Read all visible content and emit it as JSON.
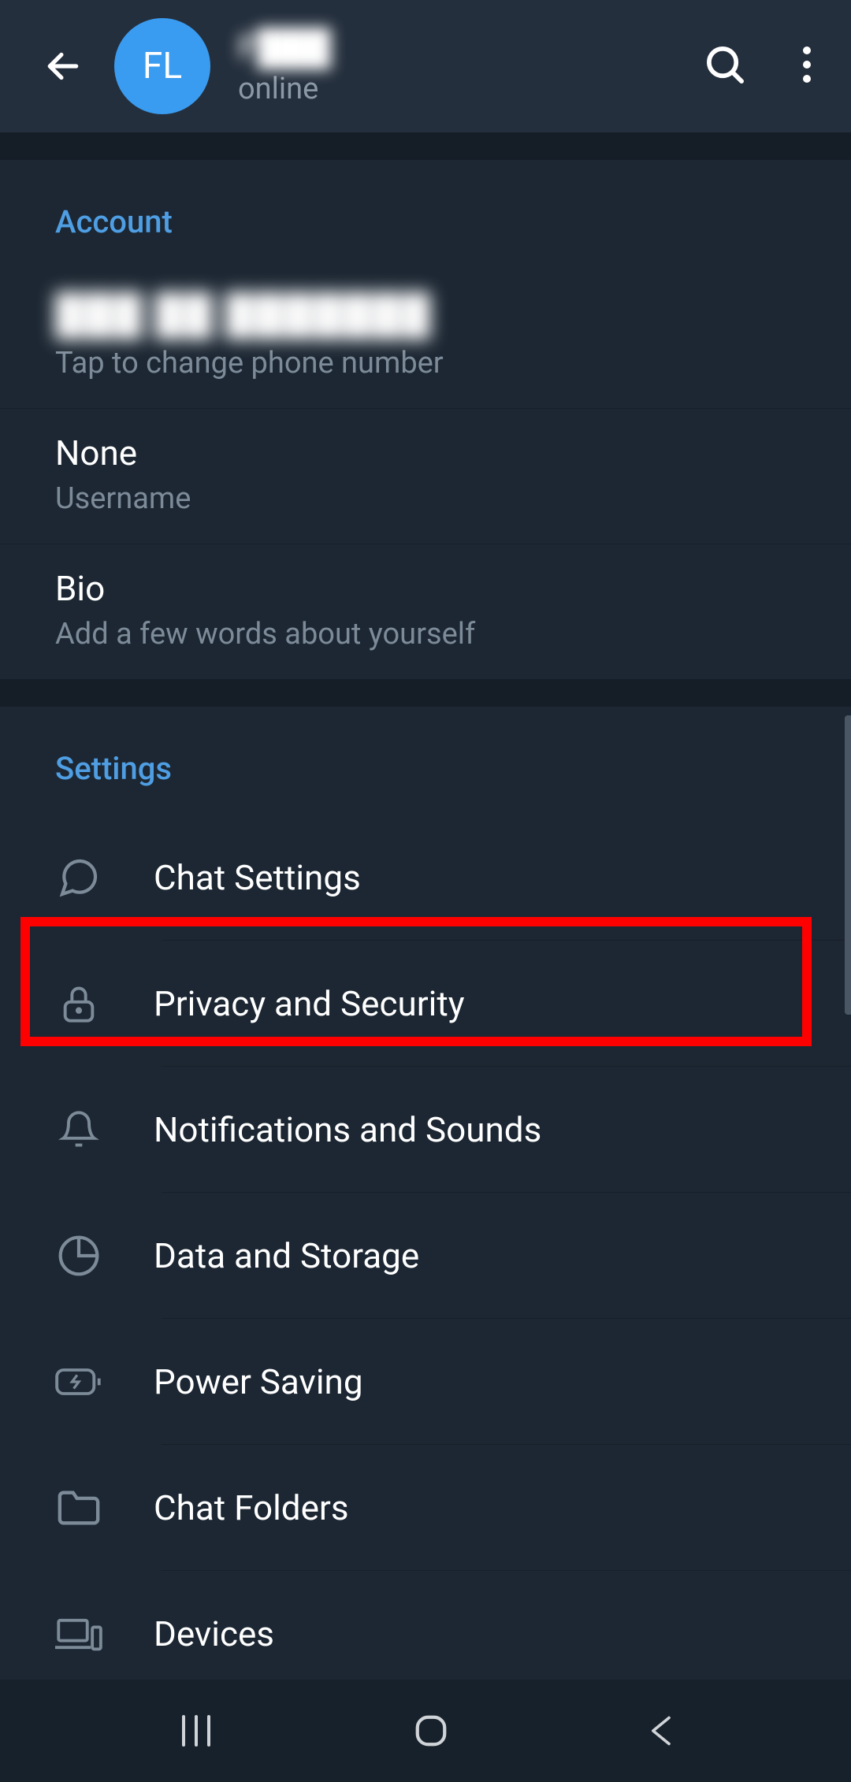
{
  "header": {
    "avatar_initials": "FL",
    "name": "F███",
    "status": "online"
  },
  "account": {
    "title": "Account",
    "phone": {
      "value": "███ ██ ███████",
      "label": "Tap to change phone number"
    },
    "username": {
      "value": "None",
      "label": "Username"
    },
    "bio": {
      "value": "Bio",
      "label": "Add a few words about yourself"
    }
  },
  "settings": {
    "title": "Settings",
    "items": [
      {
        "label": "Chat Settings",
        "icon": "chat"
      },
      {
        "label": "Privacy and Security",
        "icon": "lock"
      },
      {
        "label": "Notifications and Sounds",
        "icon": "bell"
      },
      {
        "label": "Data and Storage",
        "icon": "pie"
      },
      {
        "label": "Power Saving",
        "icon": "battery"
      },
      {
        "label": "Chat Folders",
        "icon": "folder"
      },
      {
        "label": "Devices",
        "icon": "devices"
      }
    ]
  }
}
